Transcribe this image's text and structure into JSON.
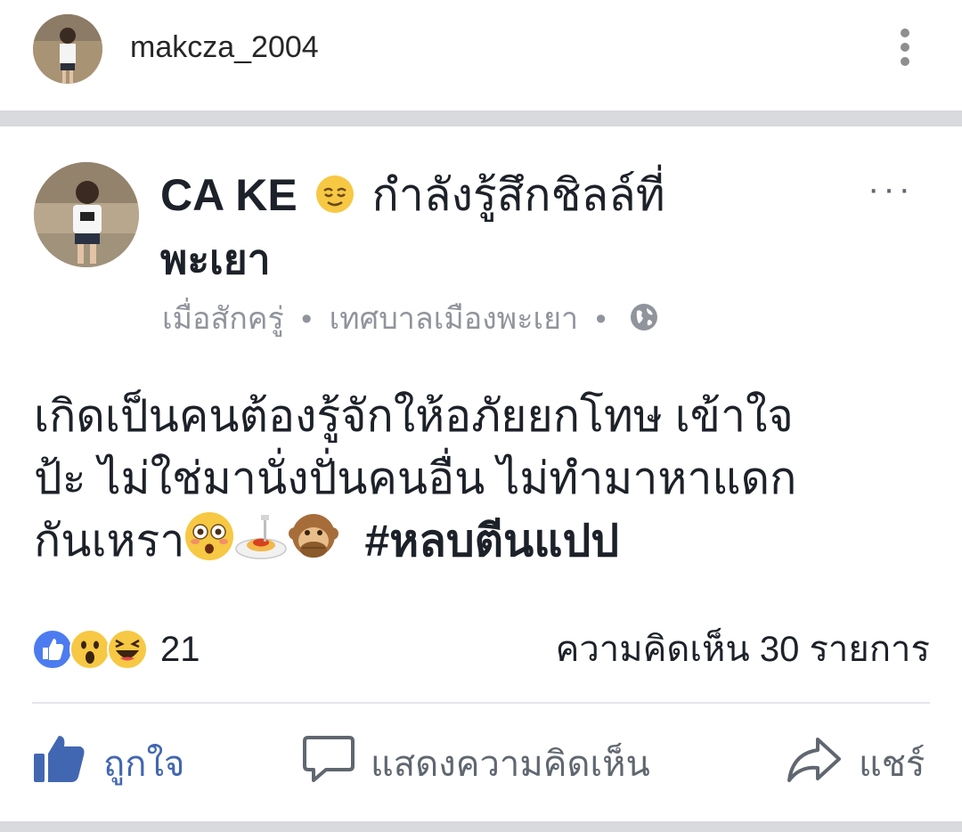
{
  "ig_header": {
    "username": "makcza_2004",
    "more_icon": "vertical-dots-icon"
  },
  "post": {
    "author": "CA KE",
    "feeling_emoji": "relieved-face-emoji",
    "feeling_text": "กำลังรู้สึกชิลล์ที่",
    "place": "พะเยา",
    "time": "เมื่อสักครู่",
    "location": "เทศบาลเมืองพะเยา",
    "separator": "•",
    "privacy_icon": "globe-icon",
    "more_icon": "horizontal-dots-icon",
    "more_label": "···",
    "body_lines": [
      "เกิดเป็นคนต้องรู้จักให้อภัยยกโทษ เข้าใจ",
      "ป้ะ ไม่ใช่มานั่งปั่นคนอื่น ไม่ทำมาหาแดก",
      "กันเหรา"
    ],
    "body_emojis": [
      "flushed-face-emoji",
      "spaghetti-emoji",
      "see-no-evil-monkey-emoji"
    ],
    "hashtag": "#หลบตีนแปป",
    "reactions": {
      "icons": [
        "like-reaction-icon",
        "wow-reaction-icon",
        "haha-reaction-icon"
      ],
      "count": "21"
    },
    "comments_count": "ความคิดเห็น 30 รายการ",
    "actions": {
      "like": "ถูกใจ",
      "comment": "แสดงความคิดเห็น",
      "share": "แชร์"
    }
  },
  "colors": {
    "fb_blue": "#4267b2",
    "meta_gray": "#90949c",
    "band_gray": "#d9dadd"
  }
}
